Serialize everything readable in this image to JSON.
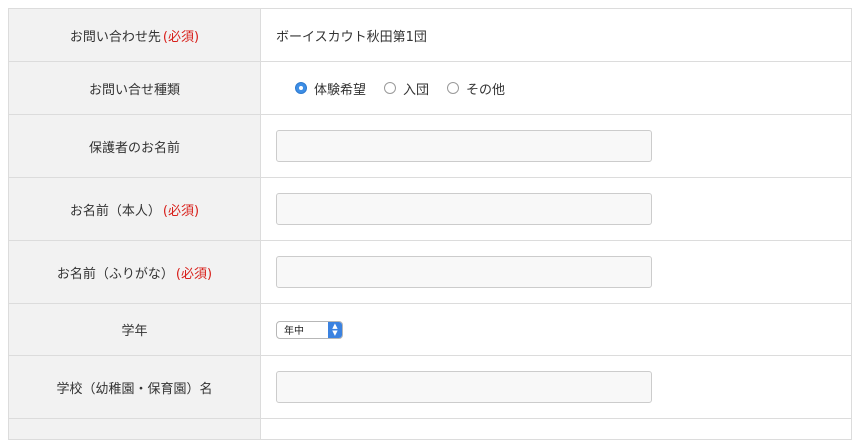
{
  "required_mark": "(必須)",
  "rows": [
    {
      "label": "お問い合わせ先",
      "value": "ボーイスカウト秋田第1団"
    },
    {
      "label": "お問い合せ種類"
    },
    {
      "label": "保護者のお名前"
    },
    {
      "label": "お名前（本人）"
    },
    {
      "label": "お名前（ふりがな）"
    },
    {
      "label": "学年"
    },
    {
      "label": "学校（幼稚園・保育園）名"
    }
  ],
  "inquiry_types": [
    {
      "label": "体験希望",
      "checked": true
    },
    {
      "label": "入団",
      "checked": false
    },
    {
      "label": "その他",
      "checked": false
    }
  ],
  "grade_select": {
    "value": "年中",
    "arrow_up": "▲",
    "arrow_down": "▼"
  },
  "colors": {
    "required": "#d8201b",
    "radio_checked": "#3d8ee6",
    "select_arrow_bg": "#3b82e0"
  }
}
